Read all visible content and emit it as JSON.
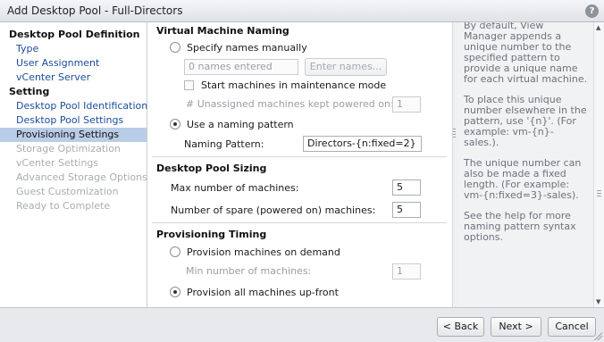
{
  "window": {
    "title": "Add Desktop Pool - Full-Directors",
    "help_icon": "?"
  },
  "sidebar": {
    "items": [
      {
        "label": "Desktop Pool Definition",
        "kind": "heading"
      },
      {
        "label": "Type",
        "kind": "link"
      },
      {
        "label": "User Assignment",
        "kind": "link"
      },
      {
        "label": "vCenter Server",
        "kind": "link"
      },
      {
        "label": "Setting",
        "kind": "heading"
      },
      {
        "label": "Desktop Pool Identification",
        "kind": "link"
      },
      {
        "label": "Desktop Pool Settings",
        "kind": "link"
      },
      {
        "label": "Provisioning Settings",
        "kind": "active"
      },
      {
        "label": "Storage Optimization",
        "kind": "disabled"
      },
      {
        "label": "vCenter Settings",
        "kind": "disabled"
      },
      {
        "label": "Advanced Storage Options",
        "kind": "disabled"
      },
      {
        "label": "Guest Customization",
        "kind": "disabled"
      },
      {
        "label": "Ready to Complete",
        "kind": "disabled"
      }
    ]
  },
  "naming": {
    "section_title": "Virtual Machine Naming",
    "specify_manually_label": "Specify names manually",
    "names_entered_placeholder": "0 names entered",
    "enter_names_button": "Enter names...",
    "maintenance_mode_label": "Start machines in maintenance mode",
    "unassigned_kept_on_label": "# Unassigned machines kept powered on:",
    "unassigned_kept_on_value": "1",
    "use_pattern_label": "Use a naming pattern",
    "pattern_label": "Naming Pattern:",
    "pattern_value": "Directors-{n:fixed=2}"
  },
  "sizing": {
    "section_title": "Desktop Pool Sizing",
    "max_label": "Max number of machines:",
    "max_value": "5",
    "spare_label": "Number of spare (powered on) machines:",
    "spare_value": "5"
  },
  "timing": {
    "section_title": "Provisioning Timing",
    "on_demand_label": "Provision machines on demand",
    "min_label": "Min number of machines:",
    "min_value": "1",
    "upfront_label": "Provision all machines up-front"
  },
  "help": {
    "paragraphs": [
      "By default, View Manager appends a unique number to the specified pattern to provide a unique name for each virtual machine.",
      "To place this unique number elsewhere in the pattern, use '{n}'. (For example: vm-{n}-sales.).",
      "The unique number can also be made a fixed length. (For example: vm-{n:fixed=3}-sales).",
      "See the help for more naming pattern syntax options."
    ]
  },
  "footer": {
    "back_label": "< Back",
    "next_label": "Next >",
    "cancel_label": "Cancel"
  }
}
